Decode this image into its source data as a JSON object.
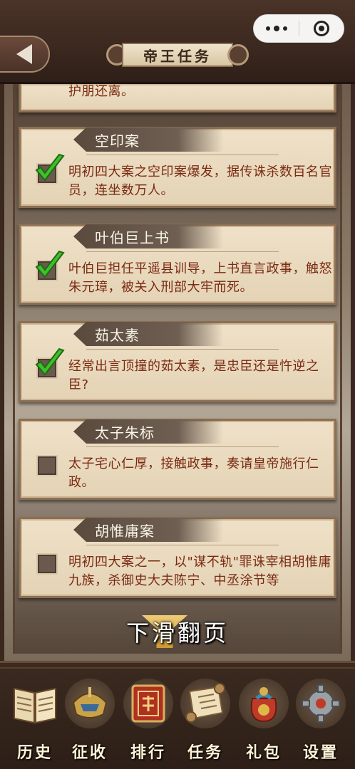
{
  "header": {
    "title": "帝王任务",
    "back_icon": "back-arrow-icon",
    "menu_icon": "more-dots-icon",
    "close_icon": "target-circle-icon"
  },
  "tasks": {
    "partial_text": "护朋还离。",
    "items": [
      {
        "title": "空印案",
        "desc": "明初四大案之空印案爆发，据传诛杀数百名官员，连坐数万人。",
        "checked": true
      },
      {
        "title": "叶伯巨上书",
        "desc": "叶伯巨担任平遥县训导，上书直言政事，触怒朱元璋，被关入刑部大牢而死。",
        "checked": true
      },
      {
        "title": "茹太素",
        "desc": "经常出言顶撞的茹太素，是忠臣还是忤逆之臣?",
        "checked": true
      },
      {
        "title": "太子朱标",
        "desc": "太子宅心仁厚，接触政事，奏请皇帝施行仁政。",
        "checked": false
      },
      {
        "title": "胡惟庸案",
        "desc": "明初四大案之一，以\"谋不轨\"罪诛宰相胡惟庸九族，杀御史大夫陈宁、中丞涂节等",
        "checked": false
      }
    ]
  },
  "swipe_hint": "下滑翻页",
  "nav": [
    {
      "label": "历史",
      "icon": "book-icon"
    },
    {
      "label": "征收",
      "icon": "helmet-icon"
    },
    {
      "label": "排行",
      "icon": "ranking-plaque-icon"
    },
    {
      "label": "任务",
      "icon": "scroll-icon"
    },
    {
      "label": "礼包",
      "icon": "gift-bag-icon"
    },
    {
      "label": "设置",
      "icon": "gear-icon"
    }
  ],
  "colors": {
    "card_bg": "#efe1c8",
    "desc_text": "#7a2a12",
    "tag_bg": "#5a4a3e",
    "check_green": "#3fbf2a"
  }
}
